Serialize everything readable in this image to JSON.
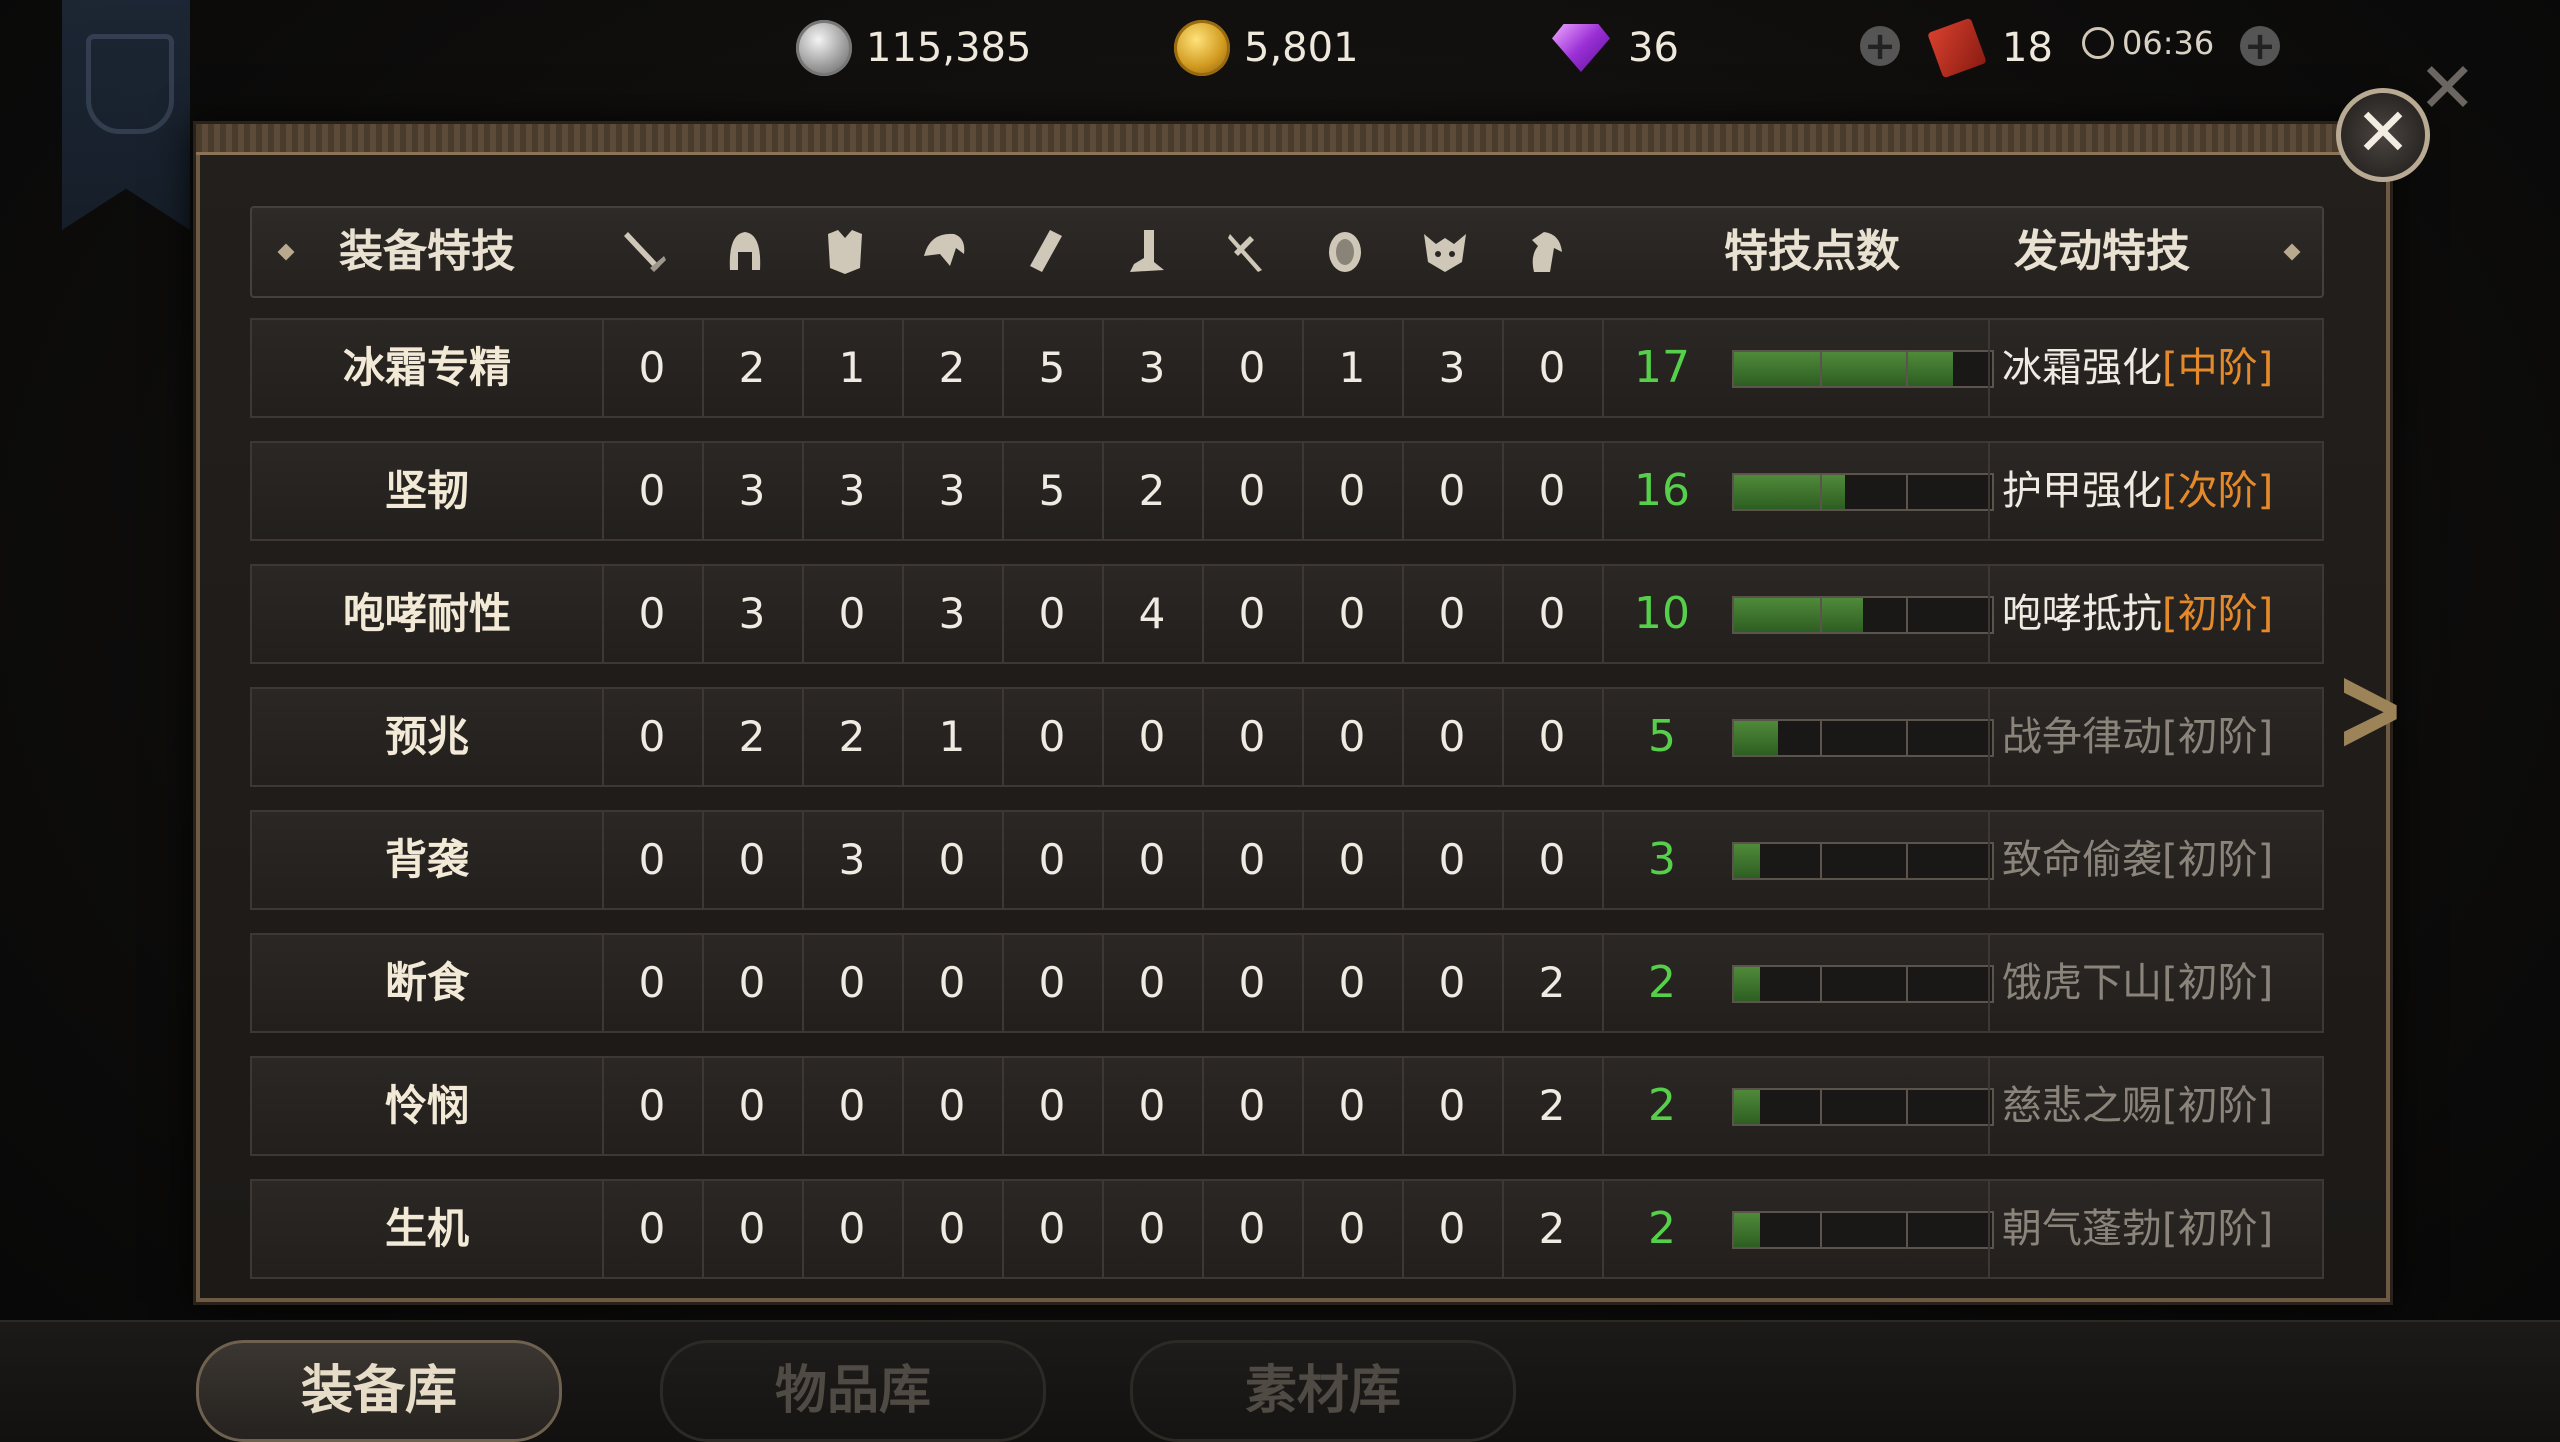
{
  "currency": {
    "silver": "115,385",
    "gold": "5,801",
    "gems": "36",
    "tickets": "18",
    "timer": "06:36"
  },
  "table": {
    "header": {
      "name_col": "装备特技",
      "points_col": "特技点数",
      "skill_col": "发动特技",
      "slot_icons": [
        "sword-icon",
        "helmet-icon",
        "armor-icon",
        "pauldron-icon",
        "bracer-icon",
        "boots-icon",
        "weapon-crossed-icon",
        "shield-icon",
        "amulet-icon",
        "horse-icon"
      ]
    },
    "rows": [
      {
        "name": "冰霜专精",
        "slots": [
          "0",
          "2",
          "1",
          "2",
          "5",
          "3",
          "0",
          "1",
          "3",
          "0"
        ],
        "points": "17",
        "progress": 0.85,
        "skill": "冰霜强化",
        "tier": "[中阶]",
        "active": true
      },
      {
        "name": "坚韧",
        "slots": [
          "0",
          "3",
          "3",
          "3",
          "5",
          "2",
          "0",
          "0",
          "0",
          "0"
        ],
        "points": "16",
        "progress": 0.43,
        "skill": "护甲强化",
        "tier": "[次阶]",
        "active": true
      },
      {
        "name": "咆哮耐性",
        "slots": [
          "0",
          "3",
          "0",
          "3",
          "0",
          "4",
          "0",
          "0",
          "0",
          "0"
        ],
        "points": "10",
        "progress": 0.5,
        "skill": "咆哮抵抗",
        "tier": "[初阶]",
        "active": true
      },
      {
        "name": "预兆",
        "slots": [
          "0",
          "2",
          "2",
          "1",
          "0",
          "0",
          "0",
          "0",
          "0",
          "0"
        ],
        "points": "5",
        "progress": 0.17,
        "skill": "战争律动",
        "tier": "[初阶]",
        "active": false
      },
      {
        "name": "背袭",
        "slots": [
          "0",
          "0",
          "3",
          "0",
          "0",
          "0",
          "0",
          "0",
          "0",
          "0"
        ],
        "points": "3",
        "progress": 0.1,
        "skill": "致命偷袭",
        "tier": "[初阶]",
        "active": false
      },
      {
        "name": "断食",
        "slots": [
          "0",
          "0",
          "0",
          "0",
          "0",
          "0",
          "0",
          "0",
          "0",
          "2"
        ],
        "points": "2",
        "progress": 0.1,
        "skill": "饿虎下山",
        "tier": "[初阶]",
        "active": false
      },
      {
        "name": "怜悯",
        "slots": [
          "0",
          "0",
          "0",
          "0",
          "0",
          "0",
          "0",
          "0",
          "0",
          "2"
        ],
        "points": "2",
        "progress": 0.1,
        "skill": "慈悲之赐",
        "tier": "[初阶]",
        "active": false
      },
      {
        "name": "生机",
        "slots": [
          "0",
          "0",
          "0",
          "0",
          "0",
          "0",
          "0",
          "0",
          "0",
          "2"
        ],
        "points": "2",
        "progress": 0.1,
        "skill": "朝气蓬勃",
        "tier": "[初阶]",
        "active": false
      }
    ]
  },
  "tabs": [
    {
      "label": "装备库",
      "active": true
    },
    {
      "label": "物品库",
      "active": false
    },
    {
      "label": "素材库",
      "active": false
    }
  ],
  "colors": {
    "points_green": "#56d04a",
    "tier_orange": "#e58a2a",
    "inactive_gray": "#8a847b"
  }
}
